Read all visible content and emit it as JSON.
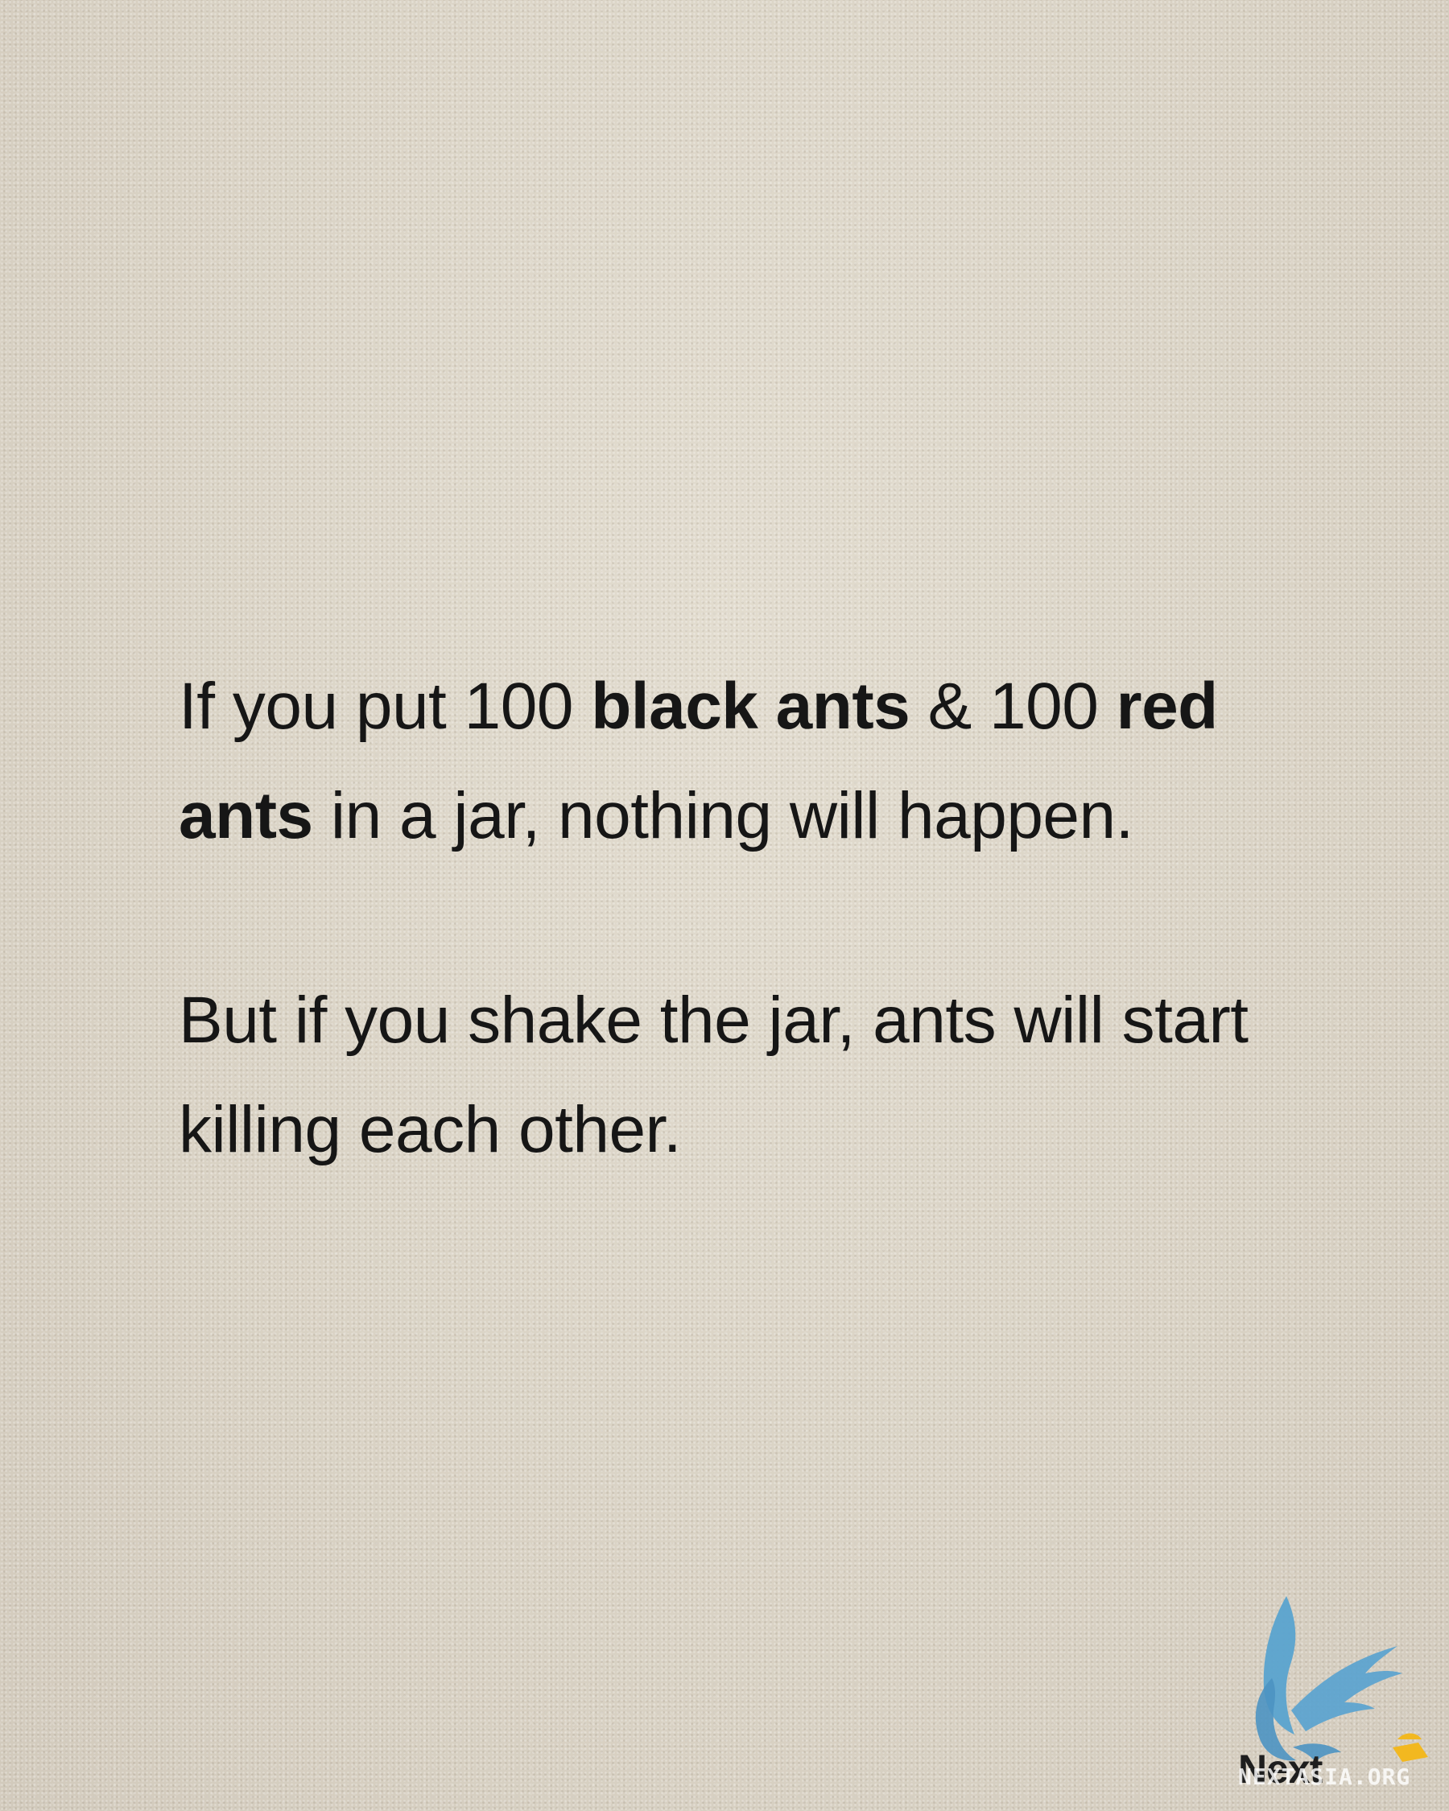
{
  "paragraph1": {
    "seg1": "If you put 100 ",
    "seg2": "black ants",
    "seg3": " & 100 ",
    "seg4": "red",
    "seg5": " ",
    "seg6": "ants",
    "seg7": " in a jar, nothing will happen."
  },
  "paragraph2": {
    "text": "But if you shake the jar, ants will start killing each other."
  },
  "logo": {
    "word": "Next",
    "domain": "NEXTASIA.ORG",
    "icon_name": "blue-bird-icon",
    "bird_color": "#5aa3cf",
    "sun_color": "#f2b820"
  },
  "colors": {
    "background": "#dcd5c8",
    "text": "#161616"
  }
}
